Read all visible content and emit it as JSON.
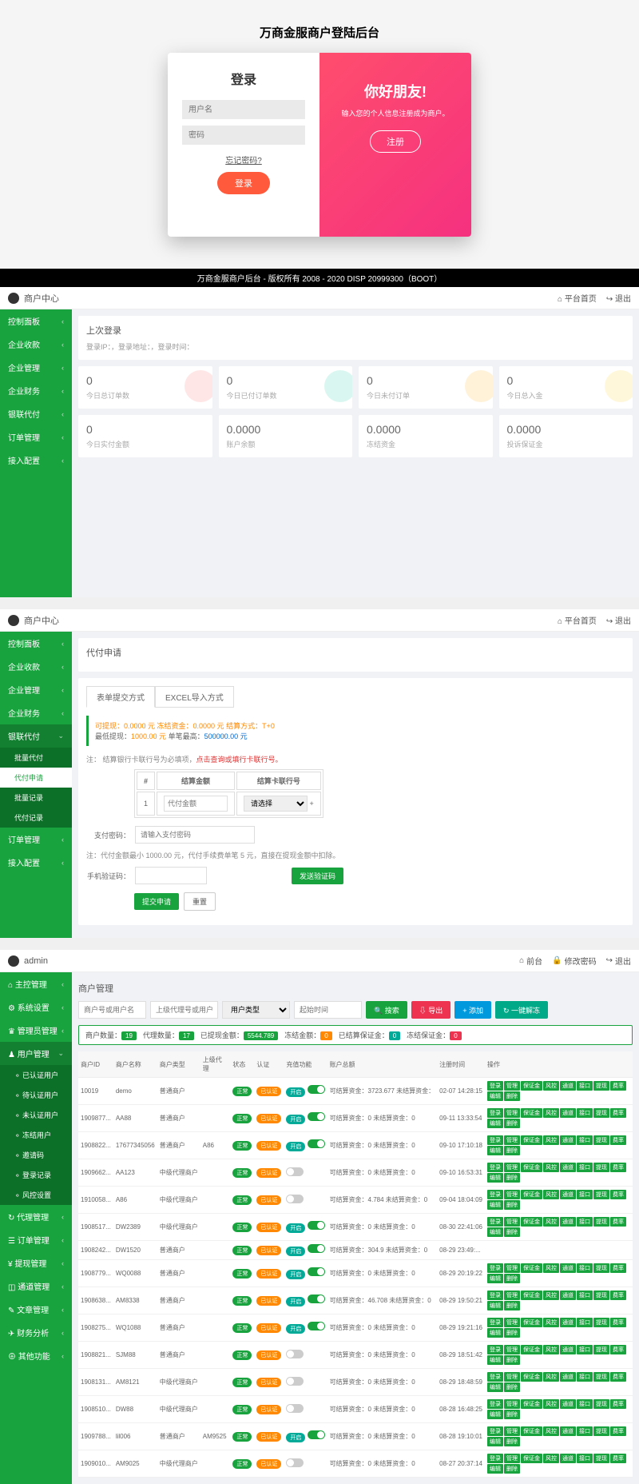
{
  "login": {
    "page_title": "万商金服商户登陆后台",
    "left_title": "登录",
    "user_placeholder": "用户名",
    "pwd_placeholder": "密码",
    "forgot": "忘记密码?",
    "login_btn": "登录",
    "right_title": "你好朋友!",
    "right_sub": "输入您的个人信息注册成为商户。",
    "reg_btn": "注册"
  },
  "black_bar": "万商金服商户后台 - 版权所有 2008 - 2020 DISP 20999300（BOOT）",
  "sec1": {
    "user": "商户中心",
    "top_right": [
      "平台首页",
      "退出"
    ],
    "sidebar": [
      "控制面板",
      "企业收款",
      "企业管理",
      "企业财务",
      "银联代付",
      "订单管理",
      "接入配置"
    ],
    "panel_title": "上次登录",
    "login_info": "登录IP：，登录地址：，登录时间：",
    "stats1": [
      {
        "num": "0",
        "lbl": "今日总订单数",
        "c": "#ff5a5a"
      },
      {
        "num": "0",
        "lbl": "今日已付订单数",
        "c": "#00cc99"
      },
      {
        "num": "0",
        "lbl": "今日未付订单",
        "c": "#ffaa00"
      },
      {
        "num": "0",
        "lbl": "今日总入金",
        "c": "#ffcc00"
      }
    ],
    "stats2": [
      {
        "num": "0",
        "lbl": "今日实付金额"
      },
      {
        "num": "0.0000",
        "lbl": "账户余额"
      },
      {
        "num": "0.0000",
        "lbl": "冻结资金"
      },
      {
        "num": "0.0000",
        "lbl": "投诉保证金"
      }
    ]
  },
  "sec2": {
    "user": "商户中心",
    "top_right": [
      "平台首页",
      "退出"
    ],
    "sidebar_main": [
      "控制面板",
      "企业收款",
      "企业管理",
      "企业财务",
      "银联代付"
    ],
    "sidebar_sub": [
      "批量代付",
      "代付申请",
      "批量记录",
      "代付记录"
    ],
    "sidebar_after": [
      "订单管理",
      "接入配置"
    ],
    "title": "代付申请",
    "tabs": [
      "表单提交方式",
      "EXCEL导入方式"
    ],
    "notice_l1a": "可提现：0.0000 元  冻结资金：0.0000 元  ",
    "notice_l1b": "结算方式：T+0",
    "notice_l2a": "最低提现：",
    "notice_l2b": "1000.00 元  ",
    "notice_l2c": "单笔最高：",
    "notice_l2d": "500000.00 元",
    "tip_prefix": "注： 结算银行卡联行号为必填项，",
    "tip_link": "点击查询或填行卡联行号。",
    "th": [
      "#",
      "结算金额",
      "结算卡联行号"
    ],
    "td": [
      "1",
      "代付金额",
      "请选择"
    ],
    "pay_pwd_label": "支付密码：",
    "pay_pwd_ph": "请输入支付密码",
    "note2": "注：代付金额最小 1000.00 元，代付手续费单笔 5 元，直接在提现金额中扣除。",
    "phone_label": "手机验证码：",
    "send_btn": "发送验证码",
    "submit": "提交申请",
    "reset": "重置"
  },
  "sec3": {
    "user": "admin",
    "top_right": [
      "前台",
      "修改密码",
      "退出"
    ],
    "sidebar": [
      {
        "t": "主控管理",
        "i": "⌂"
      },
      {
        "t": "系统设置",
        "i": "⚙"
      },
      {
        "t": "管理员管理",
        "i": "♛"
      },
      {
        "t": "用户管理",
        "i": "♟",
        "open": true,
        "subs": [
          "已认证用户",
          "待认证用户",
          "未认证用户",
          "冻结用户",
          "邀请码",
          "登录记录",
          "风控设置"
        ]
      },
      {
        "t": "代理管理",
        "i": "↻"
      },
      {
        "t": "订单管理",
        "i": "☰"
      },
      {
        "t": "提现管理",
        "i": "¥"
      },
      {
        "t": "通道管理",
        "i": "◫"
      },
      {
        "t": "文章管理",
        "i": "✎"
      },
      {
        "t": "财务分析",
        "i": "✈"
      },
      {
        "t": "其他功能",
        "i": "⊕"
      }
    ],
    "title": "商户管理",
    "search_ph": [
      "商户号或用户名",
      "上级代理号或用户名",
      "用户类型",
      "起始时间"
    ],
    "search_btns": [
      {
        "t": "搜索",
        "c": "btn-green",
        "i": "🔍"
      },
      {
        "t": "导出",
        "c": "btn-red",
        "i": "⇩"
      },
      {
        "t": "添加",
        "c": "btn-blue",
        "i": "+"
      },
      {
        "t": "一键解冻",
        "c": "btn-cyan",
        "i": "↻"
      }
    ],
    "stats": [
      {
        "l": "商户数量：",
        "v": "19",
        "c": "badge-g"
      },
      {
        "l": "代理数量：",
        "v": "17",
        "c": "badge-g"
      },
      {
        "l": "已提现金额：",
        "v": "5544.789",
        "c": "badge-g"
      },
      {
        "l": "冻结金额：",
        "v": "0",
        "c": "badge-o"
      },
      {
        "l": "已结算保证金：",
        "v": "0",
        "c": "badge-t"
      },
      {
        "l": "冻结保证金：",
        "v": "0",
        "c": "badge-r"
      }
    ],
    "th": [
      "商户ID",
      "商户名称",
      "商户类型",
      "上级代理",
      "状态",
      "认证",
      "充值功能",
      "账户总额",
      "注册时间",
      "操作"
    ],
    "ops": [
      "登录",
      "管理",
      "保证金",
      "风控",
      "通道",
      "接口",
      "提现",
      "费率",
      "编辑",
      "删除"
    ],
    "rows": [
      {
        "id": "10019",
        "name": "demo",
        "type": "普通商户",
        "agent": "",
        "status": "正常",
        "cert": "已认证",
        "charge": "开启",
        "on": true,
        "amt": "可结算资金：3723.677 未结算资金：",
        "time": "02-07 14:28:15"
      },
      {
        "id": "1909877...",
        "name": "AA88",
        "type": "普通商户",
        "agent": "",
        "status": "正常",
        "cert": "已认证",
        "charge": "开启",
        "on": true,
        "amt": "可结算资金：0 未结算资金：0",
        "time": "09-11 13:33:54"
      },
      {
        "id": "1908822...",
        "name": "17677345056",
        "type": "普通商户",
        "agent": "A86",
        "status": "正常",
        "cert": "已认证",
        "charge": "开启",
        "on": true,
        "amt": "可结算资金：0 未结算资金：0",
        "time": "09-10 17:10:18"
      },
      {
        "id": "1909662...",
        "name": "AA123",
        "type": "中级代理商户",
        "agent": "",
        "status": "正常",
        "cert": "已认证",
        "charge": "",
        "on": false,
        "amt": "可结算资金：0 未结算资金：0",
        "time": "09-10 16:53:31"
      },
      {
        "id": "1910058...",
        "name": "A86",
        "type": "中级代理商户",
        "agent": "",
        "status": "正常",
        "cert": "已认证",
        "charge": "",
        "on": false,
        "amt": "可结算资金：4.784 未结算资金：0",
        "time": "09-04 18:04:09"
      },
      {
        "id": "1908517...",
        "name": "DW2389",
        "type": "中级代理商户",
        "agent": "",
        "status": "正常",
        "cert": "已认证",
        "charge": "开启",
        "on": true,
        "amt": "可结算资金：0 未结算资金：0",
        "time": "08-30 22:41:06"
      },
      {
        "id": "1908242...",
        "name": "DW1520",
        "type": "普通商户",
        "agent": "",
        "status": "正常",
        "cert": "已认证",
        "charge": "开启",
        "on": true,
        "amt": "可结算资金：304.9 未结算资金：0",
        "time": "08-29 23:49:...",
        "noops": true
      },
      {
        "id": "1908779...",
        "name": "WQ0088",
        "type": "普通商户",
        "agent": "",
        "status": "正常",
        "cert": "已认证",
        "charge": "开启",
        "on": true,
        "amt": "可结算资金：0 未结算资金：0",
        "time": "08-29 20:19:22"
      },
      {
        "id": "1908638...",
        "name": "AM8338",
        "type": "普通商户",
        "agent": "",
        "status": "正常",
        "cert": "已认证",
        "charge": "开启",
        "on": true,
        "amt": "可结算资金：46.708 未结算资金：0",
        "time": "08-29 19:50:21"
      },
      {
        "id": "1908275...",
        "name": "WQ1088",
        "type": "普通商户",
        "agent": "",
        "status": "正常",
        "cert": "已认证",
        "charge": "开启",
        "on": true,
        "amt": "可结算资金：0 未结算资金：0",
        "time": "08-29 19:21:16"
      },
      {
        "id": "1908821...",
        "name": "SJM88",
        "type": "普通商户",
        "agent": "",
        "status": "正常",
        "cert": "已认证",
        "charge": "",
        "on": false,
        "amt": "可结算资金：0 未结算资金：0",
        "time": "08-29 18:51:42"
      },
      {
        "id": "1908131...",
        "name": "AM8121",
        "type": "中级代理商户",
        "agent": "",
        "status": "正常",
        "cert": "已认证",
        "charge": "",
        "on": false,
        "amt": "可结算资金：0 未结算资金：0",
        "time": "08-29 18:48:59"
      },
      {
        "id": "1908510...",
        "name": "DW88",
        "type": "中级代理商户",
        "agent": "",
        "status": "正常",
        "cert": "已认证",
        "charge": "",
        "on": false,
        "amt": "可结算资金：0 未结算资金：0",
        "time": "08-28 16:48:25"
      },
      {
        "id": "1909788...",
        "name": "lil006",
        "type": "普通商户",
        "agent": "AM9525",
        "status": "正常",
        "cert": "已认证",
        "charge": "开启",
        "on": true,
        "amt": "可结算资金：0 未结算资金：0",
        "time": "08-28 19:10:01"
      },
      {
        "id": "1909010...",
        "name": "AM9025",
        "type": "中级代理商户",
        "agent": "",
        "status": "正常",
        "cert": "已认证",
        "charge": "",
        "on": false,
        "amt": "可结算资金：0 未结算资金：0",
        "time": "08-27 20:37:14"
      }
    ]
  }
}
